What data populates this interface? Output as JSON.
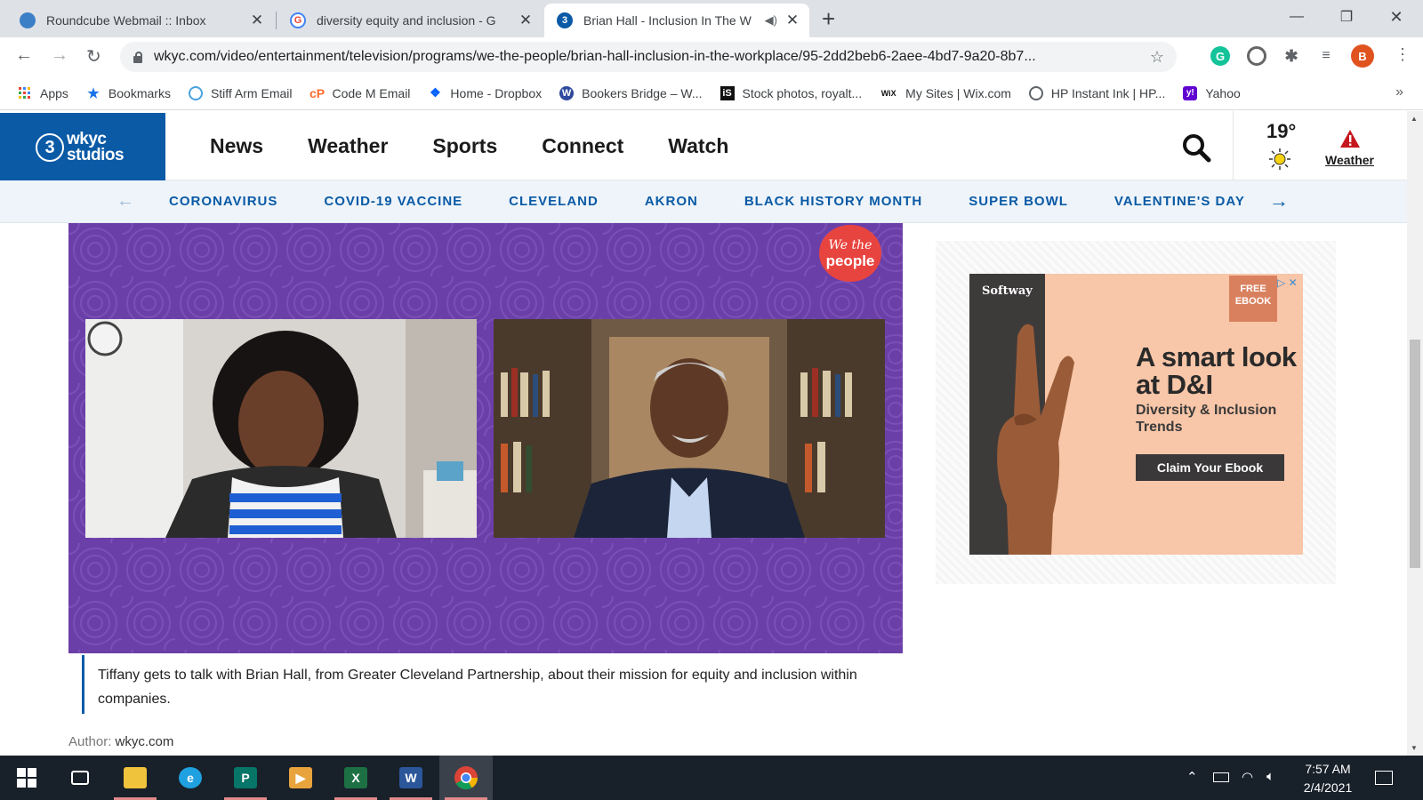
{
  "browser": {
    "tabs": [
      {
        "title": "Roundcube Webmail :: Inbox",
        "active": false
      },
      {
        "title": "diversity equity and inclusion - G",
        "active": false
      },
      {
        "title": "Brian Hall - Inclusion In The W",
        "active": true,
        "favicon_text": "3"
      }
    ],
    "url": "wkyc.com/video/entertainment/television/programs/we-the-people/brian-hall-inclusion-in-the-workplace/95-2dd2beb6-2aee-4bd7-9a20-8b7...",
    "profile_initial": "B",
    "bookmarks": [
      {
        "label": "Apps",
        "icon": "apps-grid-icon"
      },
      {
        "label": "Bookmarks",
        "icon": "star-icon"
      },
      {
        "label": "Stiff Arm Email",
        "icon": "email-icon"
      },
      {
        "label": "Code M Email",
        "icon": "cpanel-icon"
      },
      {
        "label": "Home - Dropbox",
        "icon": "dropbox-icon"
      },
      {
        "label": "Bookers Bridge – W...",
        "icon": "wordpress-icon"
      },
      {
        "label": "Stock photos, royalt...",
        "icon": "istock-icon"
      },
      {
        "label": "My Sites | Wix.com",
        "icon": "wix-icon"
      },
      {
        "label": "HP Instant Ink | HP...",
        "icon": "globe-icon"
      },
      {
        "label": "Yahoo",
        "icon": "yahoo-icon"
      }
    ]
  },
  "site": {
    "logo_number": "3",
    "logo_text_1": "wkyc",
    "logo_text_2": "studios",
    "nav": [
      "News",
      "Weather",
      "Sports",
      "Connect",
      "Watch"
    ],
    "weather": {
      "temp": "19°",
      "label": "Weather"
    },
    "trending": [
      "CORONAVIRUS",
      "COVID-19 VACCINE",
      "CLEVELAND",
      "AKRON",
      "BLACK HISTORY MONTH",
      "SUPER BOWL",
      "VALENTINE'S DAY"
    ],
    "video_badge_1": "We the",
    "video_badge_2": "people",
    "caption": "Tiffany gets to talk with Brian Hall, from Greater Cleveland Partnership, about their mission for equity and inclusion within companies.",
    "author_label": "Author:",
    "author_value": "wkyc.com"
  },
  "ad": {
    "brand": "Softway",
    "free_line1": "FREE",
    "free_line2": "EBOOK",
    "headline": "A smart look at D&I",
    "subhead": "Diversity & Inclusion Trends",
    "cta": "Claim Your Ebook"
  },
  "taskbar": {
    "time": "7:57 AM",
    "date": "2/4/2021"
  },
  "colors": {
    "brand_blue": "#0a5aa6",
    "video_purple": "#6b3fa8",
    "badge_red": "#e8443f",
    "ad_peach": "#f8c6a8"
  }
}
